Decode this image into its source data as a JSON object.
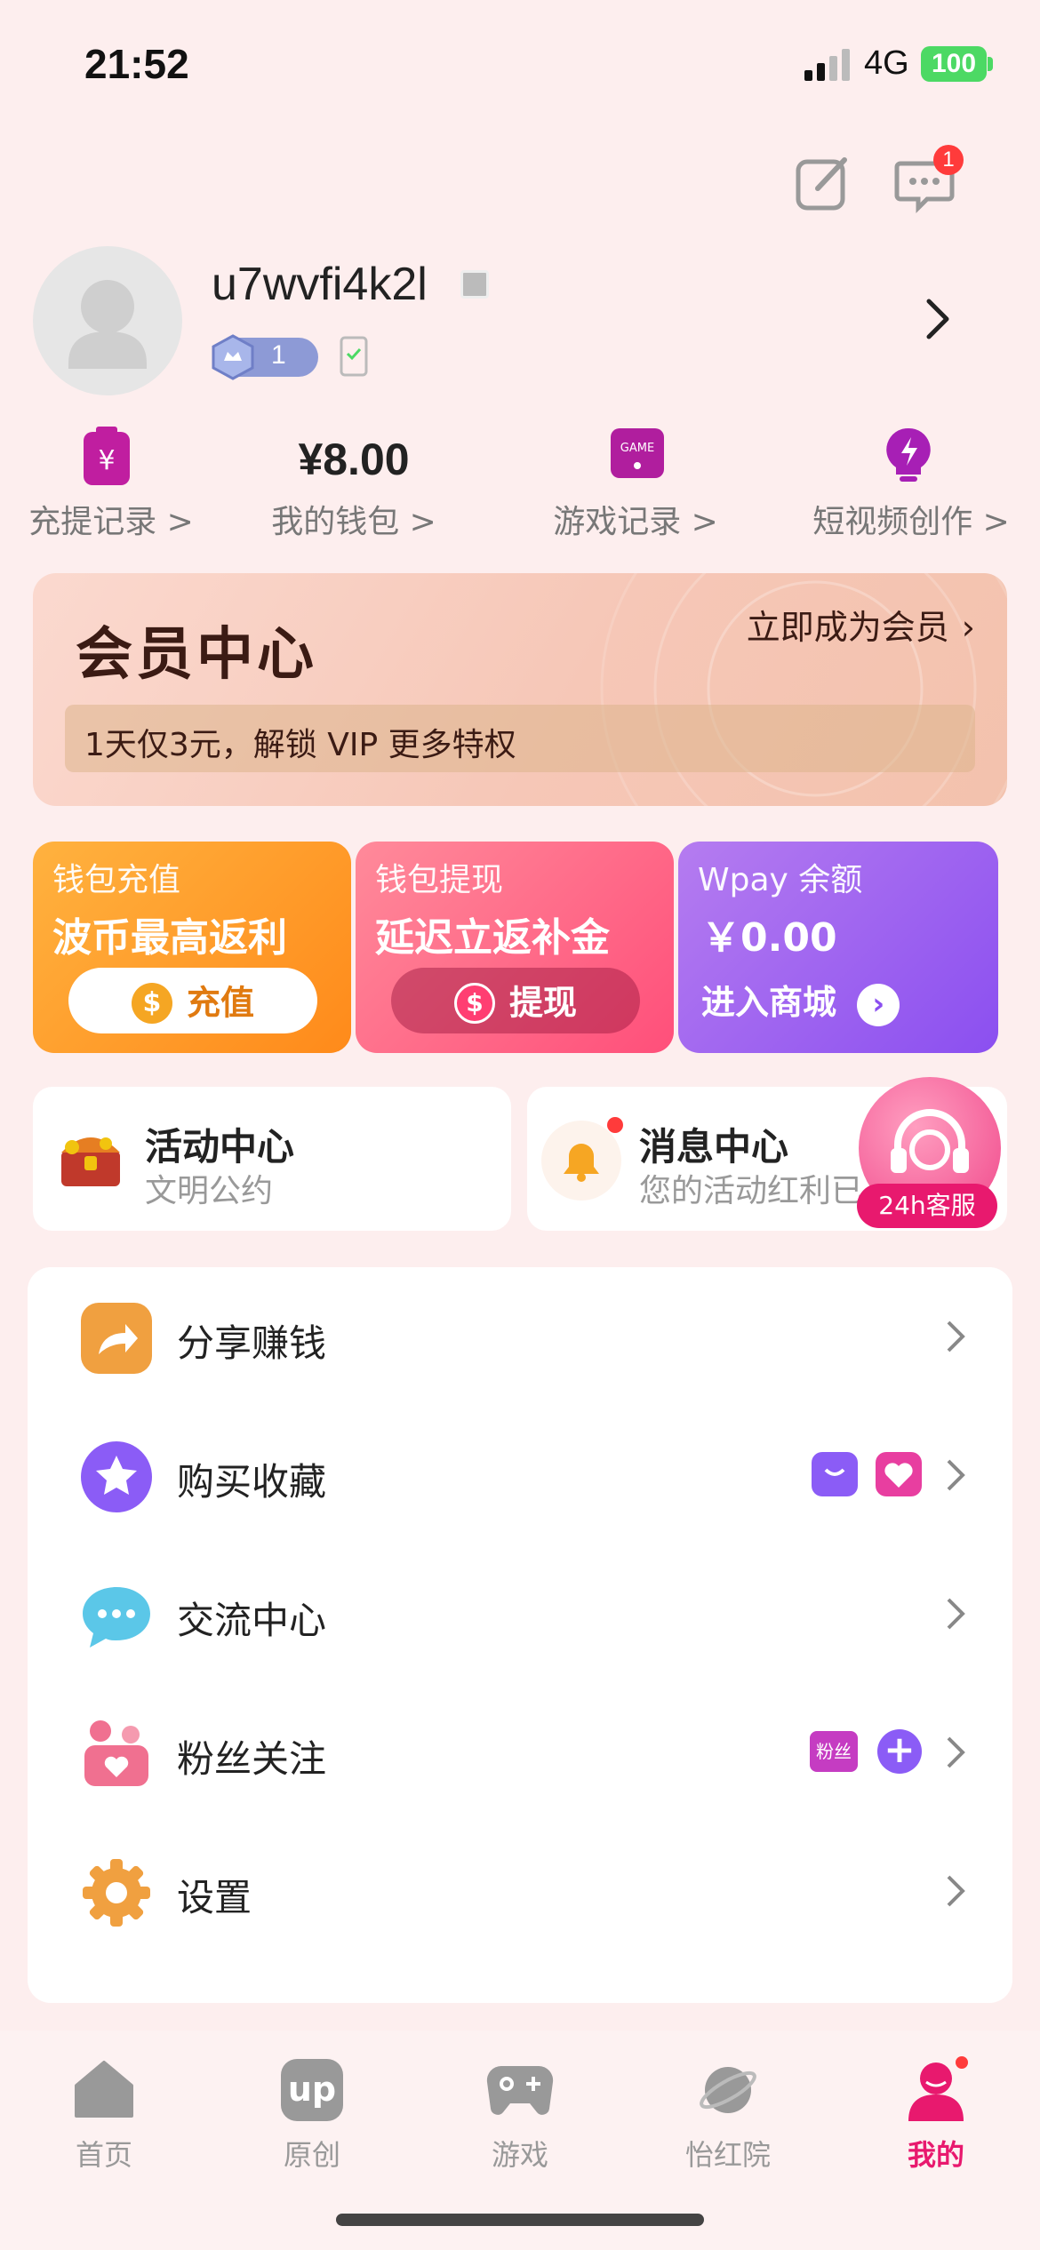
{
  "status_bar": {
    "time": "21:52",
    "network": "4G",
    "battery": "100"
  },
  "header": {
    "message_badge": "1"
  },
  "profile": {
    "username": "u7wvfi4k2l",
    "level": "1"
  },
  "quick_links": [
    {
      "label": "充提记录 >",
      "icon": "wallet-yuan-icon"
    },
    {
      "label": "我的钱包 >",
      "value": "¥8.00"
    },
    {
      "label": "游戏记录 >",
      "icon": "game-icon"
    },
    {
      "label": "短视频创作 >",
      "icon": "bulb-flash-icon"
    }
  ],
  "vip": {
    "title": "会员中心",
    "cta": "立即成为会员",
    "promo": "1天仅3元，解锁 VIP 更多特权"
  },
  "cards": [
    {
      "title": "钱包充值",
      "subtitle": "波币最高返利",
      "button": "充值"
    },
    {
      "title": "钱包提现",
      "subtitle": "延迟立返补金",
      "button": "提现"
    },
    {
      "title": "Wpay 余额",
      "subtitle": "￥0.00",
      "button": "进入商城"
    }
  ],
  "panels": [
    {
      "title": "活动中心",
      "subtitle": "文明公约"
    },
    {
      "title": "消息中心",
      "subtitle": "您的活动红利已"
    }
  ],
  "support": {
    "label": "24h客服"
  },
  "menu": [
    {
      "label": "分享赚钱",
      "icon": "share-icon",
      "color": "#f0a040"
    },
    {
      "label": "购买收藏",
      "icon": "star-icon",
      "color": "#8b5cf6"
    },
    {
      "label": "交流中心",
      "icon": "chat-bubble-icon",
      "color": "#5bc7e8"
    },
    {
      "label": "粉丝关注",
      "icon": "fans-icon",
      "color": "#f07090",
      "tag": "粉丝"
    },
    {
      "label": "设置",
      "icon": "gear-icon",
      "color": "#f0a040"
    }
  ],
  "tabs": [
    {
      "label": "首页",
      "icon": "home-icon"
    },
    {
      "label": "原创",
      "icon": "up-icon"
    },
    {
      "label": "游戏",
      "icon": "gamepad-icon"
    },
    {
      "label": "怡红院",
      "icon": "planet-icon"
    },
    {
      "label": "我的",
      "icon": "user-icon",
      "active": true
    }
  ],
  "colors": {
    "accent": "#e8196e",
    "background": "#fdeeee"
  }
}
